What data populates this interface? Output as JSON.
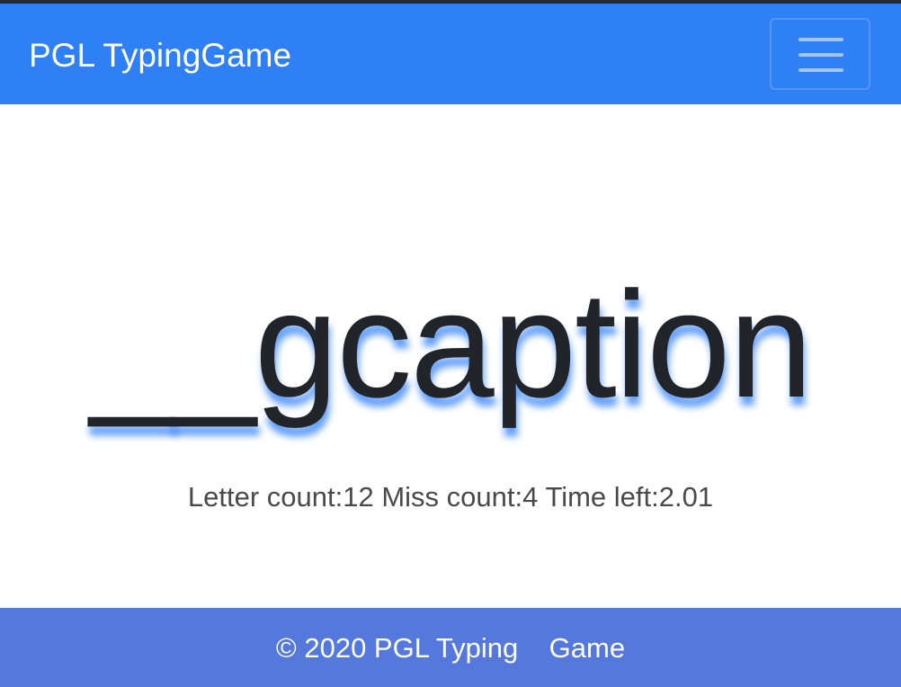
{
  "navbar": {
    "brand": "PGL TypingGame",
    "menu_icon": "hamburger-menu-icon",
    "color": "#2f7ff5"
  },
  "game": {
    "word": "__gcaption",
    "stats": {
      "letter_label": "Letter count:",
      "letter_value": "12",
      "miss_label": "Miss count:",
      "miss_value": "4",
      "time_label": "Time left:",
      "time_value": "2.01"
    }
  },
  "footer": {
    "text": "© 2020 PGL Typing    Game",
    "color": "#5578dc"
  }
}
